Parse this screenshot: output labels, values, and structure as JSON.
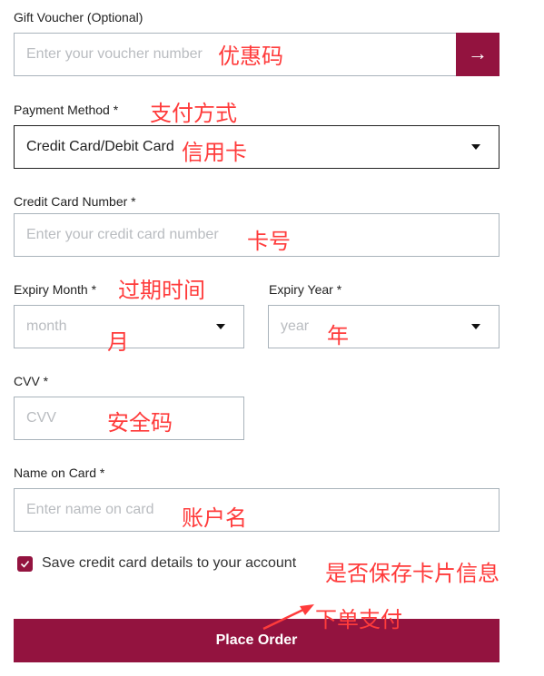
{
  "voucher": {
    "label": "Gift Voucher (Optional)",
    "placeholder": "Enter your voucher number",
    "submit_icon": "arrow-right-icon",
    "submit_glyph": "→"
  },
  "payment_method": {
    "label": "Payment Method *",
    "value": "Credit Card/Debit Card"
  },
  "card_number": {
    "label": "Credit Card Number *",
    "placeholder": "Enter your credit card number"
  },
  "expiry_month": {
    "label": "Expiry Month *",
    "placeholder": "month"
  },
  "expiry_year": {
    "label": "Expiry Year *",
    "placeholder": "year"
  },
  "cvv": {
    "label": "CVV *",
    "placeholder": "CVV"
  },
  "name_on_card": {
    "label": "Name on Card *",
    "placeholder": "Enter name on card"
  },
  "save_card": {
    "label": "Save credit card details to your account",
    "checked": true
  },
  "place_order": {
    "label": "Place Order"
  },
  "annotations": {
    "voucher": "优惠码",
    "payment_method": "支付方式",
    "credit_card": "信用卡",
    "card_number": "卡号",
    "expiry": "过期时间",
    "month": "月",
    "year": "年",
    "cvv": "安全码",
    "name": "账户名",
    "save": "是否保存卡片信息",
    "place_order": "下单支付"
  },
  "colors": {
    "brand": "#93133f",
    "annotation": "#ff3b3b"
  }
}
